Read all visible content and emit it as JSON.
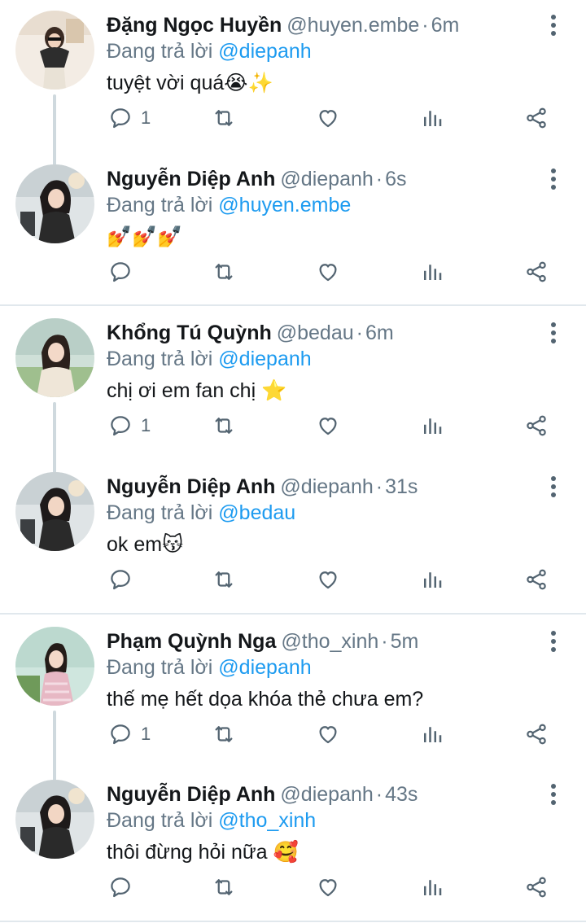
{
  "reply_prefix": "Đang trả lời",
  "colors": {
    "mention": "#1d9bf0",
    "secondary": "#657786",
    "icon": "#536471"
  },
  "tweets": [
    {
      "name": "Đặng Ngọc Huyền",
      "handle": "@huyen.embe",
      "time": "6m",
      "reply_to": "@diepanh",
      "text": "tuyệt vời quá",
      "emoji": "😭✨",
      "reply_count": "1",
      "avatar_icon": "avatar-huyen"
    },
    {
      "name": "Nguyễn Diệp Anh",
      "handle": "@diepanh",
      "time": "6s",
      "reply_to": "@huyen.embe",
      "text": "",
      "emoji": "💅💅💅",
      "reply_count": "",
      "avatar_icon": "avatar-diepanh"
    },
    {
      "name": "Khổng Tú Quỳnh",
      "handle": "@bedau",
      "time": "6m",
      "reply_to": "@diepanh",
      "text": "chị ơi em fan chị ",
      "emoji": "⭐",
      "reply_count": "1",
      "avatar_icon": "avatar-quynh"
    },
    {
      "name": "Nguyễn Diệp Anh",
      "handle": "@diepanh",
      "time": "31s",
      "reply_to": "@bedau",
      "text": "ok em",
      "emoji": "😽",
      "reply_count": "",
      "avatar_icon": "avatar-diepanh"
    },
    {
      "name": "Phạm Quỳnh Nga",
      "handle": "@tho_xinh",
      "time": "5m",
      "reply_to": "@diepanh",
      "text": "thế mẹ hết dọa khóa thẻ chưa em?",
      "emoji": "",
      "reply_count": "1",
      "avatar_icon": "avatar-nga"
    },
    {
      "name": "Nguyễn Diệp Anh",
      "handle": "@diepanh",
      "time": "43s",
      "reply_to": "@tho_xinh",
      "text": "thôi đừng hỏi nữa ",
      "emoji": "🥰",
      "reply_count": "",
      "avatar_icon": "avatar-diepanh"
    }
  ]
}
